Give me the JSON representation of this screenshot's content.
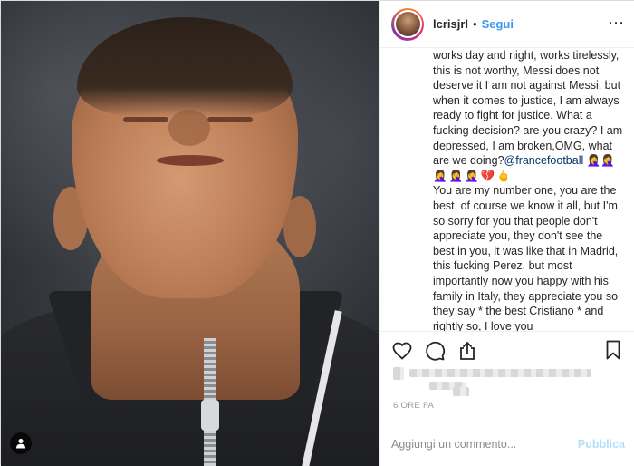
{
  "post": {
    "username": "lcrisjrl",
    "separator": "•",
    "follow_label": "Segui",
    "more_icon": "ellipsis-icon",
    "caption_lines": [
      "works day and night, works tirelessly,",
      "this is not worthy, Messi does not",
      "deserve it I am not against Messi, but",
      "when it comes to justice, I am always",
      "ready to fight for justice. What a",
      "fucking decision? are you crazy? I am",
      "depressed, I am broken,OMG, what",
      "are we doing?"
    ],
    "mention": "@francefootball",
    "emoji_line_1": "🤦‍♀️🤦‍♀️",
    "emoji_line_2": "🤦‍♀️🤦‍♀️🤦‍♀️💔🖕",
    "caption_part2_lines": [
      "You are my number one, you are the",
      "best, of course we know it all, but I'm",
      "so sorry for you that people don't",
      "appreciate you, they don't see the",
      "best in you, it was like that in Madrid,",
      "this fucking Perez, but most",
      "importantly now you happy with his",
      "family in Italy, they appreciate you so",
      "they say * the best Cristiano * and",
      "rightly so, I love you"
    ],
    "timestamp": "6 ORE FA"
  },
  "comment": {
    "placeholder": "Aggiungi un commento...",
    "publish_label": "Pubblica"
  },
  "colors": {
    "link_blue": "#3897f0",
    "publish_disabled": "#b2dffc",
    "mention": "#003569",
    "muted": "#999999"
  }
}
